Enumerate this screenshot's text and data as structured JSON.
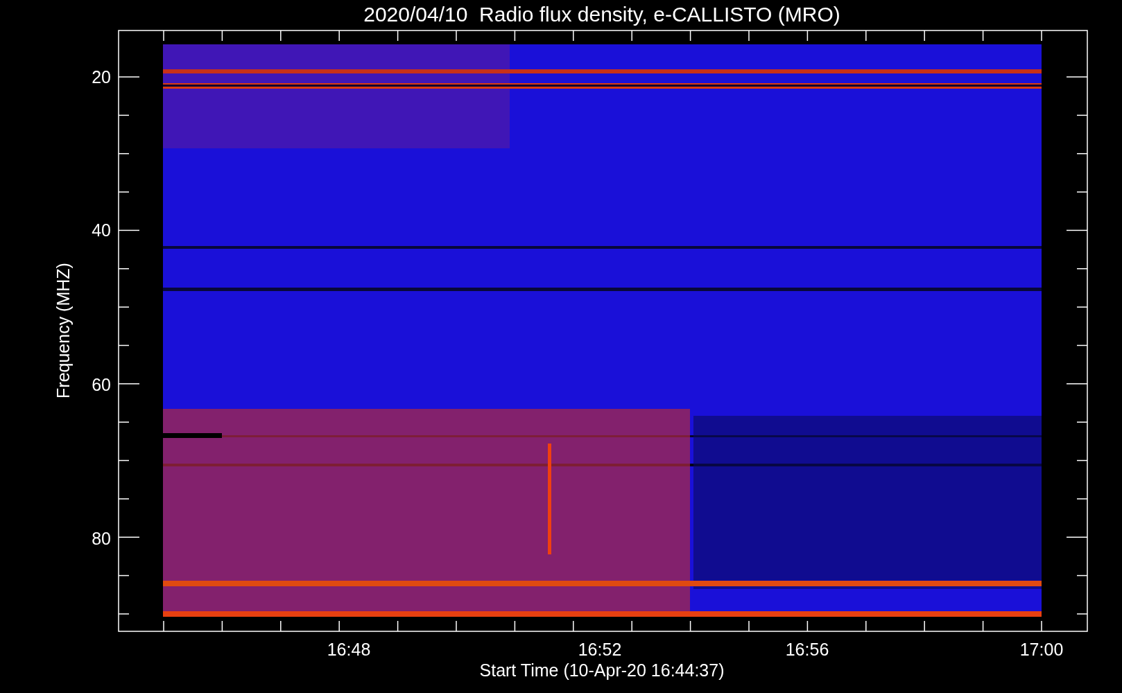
{
  "title": "2020/04/10  Radio flux density, e-CALLISTO (MRO)",
  "y_axis": {
    "label": "Frequency (MHZ)",
    "ticks": [
      "20",
      "40",
      "60",
      "80"
    ]
  },
  "x_axis": {
    "label": "Start Time (10-Apr-20 16:44:37)",
    "ticks": [
      "16:48",
      "16:52",
      "16:56",
      "17:00"
    ]
  }
}
